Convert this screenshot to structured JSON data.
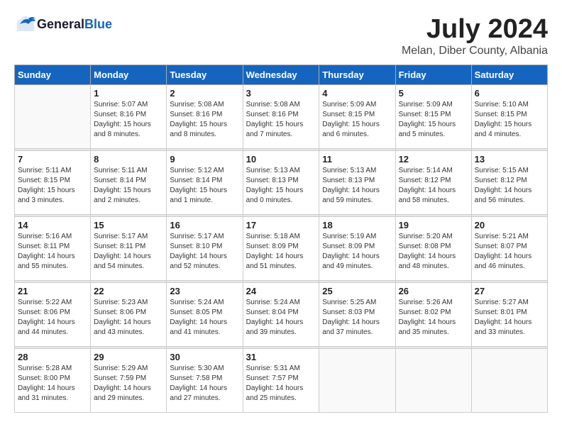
{
  "logo": {
    "general": "General",
    "blue": "Blue"
  },
  "title": {
    "month_year": "July 2024",
    "location": "Melan, Diber County, Albania"
  },
  "weekdays": [
    "Sunday",
    "Monday",
    "Tuesday",
    "Wednesday",
    "Thursday",
    "Friday",
    "Saturday"
  ],
  "weeks": [
    [
      {
        "day": "",
        "sunrise": "",
        "sunset": "",
        "daylight": ""
      },
      {
        "day": "1",
        "sunrise": "Sunrise: 5:07 AM",
        "sunset": "Sunset: 8:16 PM",
        "daylight": "Daylight: 15 hours and 8 minutes."
      },
      {
        "day": "2",
        "sunrise": "Sunrise: 5:08 AM",
        "sunset": "Sunset: 8:16 PM",
        "daylight": "Daylight: 15 hours and 8 minutes."
      },
      {
        "day": "3",
        "sunrise": "Sunrise: 5:08 AM",
        "sunset": "Sunset: 8:16 PM",
        "daylight": "Daylight: 15 hours and 7 minutes."
      },
      {
        "day": "4",
        "sunrise": "Sunrise: 5:09 AM",
        "sunset": "Sunset: 8:15 PM",
        "daylight": "Daylight: 15 hours and 6 minutes."
      },
      {
        "day": "5",
        "sunrise": "Sunrise: 5:09 AM",
        "sunset": "Sunset: 8:15 PM",
        "daylight": "Daylight: 15 hours and 5 minutes."
      },
      {
        "day": "6",
        "sunrise": "Sunrise: 5:10 AM",
        "sunset": "Sunset: 8:15 PM",
        "daylight": "Daylight: 15 hours and 4 minutes."
      }
    ],
    [
      {
        "day": "7",
        "sunrise": "Sunrise: 5:11 AM",
        "sunset": "Sunset: 8:15 PM",
        "daylight": "Daylight: 15 hours and 3 minutes."
      },
      {
        "day": "8",
        "sunrise": "Sunrise: 5:11 AM",
        "sunset": "Sunset: 8:14 PM",
        "daylight": "Daylight: 15 hours and 2 minutes."
      },
      {
        "day": "9",
        "sunrise": "Sunrise: 5:12 AM",
        "sunset": "Sunset: 8:14 PM",
        "daylight": "Daylight: 15 hours and 1 minute."
      },
      {
        "day": "10",
        "sunrise": "Sunrise: 5:13 AM",
        "sunset": "Sunset: 8:13 PM",
        "daylight": "Daylight: 15 hours and 0 minutes."
      },
      {
        "day": "11",
        "sunrise": "Sunrise: 5:13 AM",
        "sunset": "Sunset: 8:13 PM",
        "daylight": "Daylight: 14 hours and 59 minutes."
      },
      {
        "day": "12",
        "sunrise": "Sunrise: 5:14 AM",
        "sunset": "Sunset: 8:12 PM",
        "daylight": "Daylight: 14 hours and 58 minutes."
      },
      {
        "day": "13",
        "sunrise": "Sunrise: 5:15 AM",
        "sunset": "Sunset: 8:12 PM",
        "daylight": "Daylight: 14 hours and 56 minutes."
      }
    ],
    [
      {
        "day": "14",
        "sunrise": "Sunrise: 5:16 AM",
        "sunset": "Sunset: 8:11 PM",
        "daylight": "Daylight: 14 hours and 55 minutes."
      },
      {
        "day": "15",
        "sunrise": "Sunrise: 5:17 AM",
        "sunset": "Sunset: 8:11 PM",
        "daylight": "Daylight: 14 hours and 54 minutes."
      },
      {
        "day": "16",
        "sunrise": "Sunrise: 5:17 AM",
        "sunset": "Sunset: 8:10 PM",
        "daylight": "Daylight: 14 hours and 52 minutes."
      },
      {
        "day": "17",
        "sunrise": "Sunrise: 5:18 AM",
        "sunset": "Sunset: 8:09 PM",
        "daylight": "Daylight: 14 hours and 51 minutes."
      },
      {
        "day": "18",
        "sunrise": "Sunrise: 5:19 AM",
        "sunset": "Sunset: 8:09 PM",
        "daylight": "Daylight: 14 hours and 49 minutes."
      },
      {
        "day": "19",
        "sunrise": "Sunrise: 5:20 AM",
        "sunset": "Sunset: 8:08 PM",
        "daylight": "Daylight: 14 hours and 48 minutes."
      },
      {
        "day": "20",
        "sunrise": "Sunrise: 5:21 AM",
        "sunset": "Sunset: 8:07 PM",
        "daylight": "Daylight: 14 hours and 46 minutes."
      }
    ],
    [
      {
        "day": "21",
        "sunrise": "Sunrise: 5:22 AM",
        "sunset": "Sunset: 8:06 PM",
        "daylight": "Daylight: 14 hours and 44 minutes."
      },
      {
        "day": "22",
        "sunrise": "Sunrise: 5:23 AM",
        "sunset": "Sunset: 8:06 PM",
        "daylight": "Daylight: 14 hours and 43 minutes."
      },
      {
        "day": "23",
        "sunrise": "Sunrise: 5:24 AM",
        "sunset": "Sunset: 8:05 PM",
        "daylight": "Daylight: 14 hours and 41 minutes."
      },
      {
        "day": "24",
        "sunrise": "Sunrise: 5:24 AM",
        "sunset": "Sunset: 8:04 PM",
        "daylight": "Daylight: 14 hours and 39 minutes."
      },
      {
        "day": "25",
        "sunrise": "Sunrise: 5:25 AM",
        "sunset": "Sunset: 8:03 PM",
        "daylight": "Daylight: 14 hours and 37 minutes."
      },
      {
        "day": "26",
        "sunrise": "Sunrise: 5:26 AM",
        "sunset": "Sunset: 8:02 PM",
        "daylight": "Daylight: 14 hours and 35 minutes."
      },
      {
        "day": "27",
        "sunrise": "Sunrise: 5:27 AM",
        "sunset": "Sunset: 8:01 PM",
        "daylight": "Daylight: 14 hours and 33 minutes."
      }
    ],
    [
      {
        "day": "28",
        "sunrise": "Sunrise: 5:28 AM",
        "sunset": "Sunset: 8:00 PM",
        "daylight": "Daylight: 14 hours and 31 minutes."
      },
      {
        "day": "29",
        "sunrise": "Sunrise: 5:29 AM",
        "sunset": "Sunset: 7:59 PM",
        "daylight": "Daylight: 14 hours and 29 minutes."
      },
      {
        "day": "30",
        "sunrise": "Sunrise: 5:30 AM",
        "sunset": "Sunset: 7:58 PM",
        "daylight": "Daylight: 14 hours and 27 minutes."
      },
      {
        "day": "31",
        "sunrise": "Sunrise: 5:31 AM",
        "sunset": "Sunset: 7:57 PM",
        "daylight": "Daylight: 14 hours and 25 minutes."
      },
      {
        "day": "",
        "sunrise": "",
        "sunset": "",
        "daylight": ""
      },
      {
        "day": "",
        "sunrise": "",
        "sunset": "",
        "daylight": ""
      },
      {
        "day": "",
        "sunrise": "",
        "sunset": "",
        "daylight": ""
      }
    ]
  ]
}
